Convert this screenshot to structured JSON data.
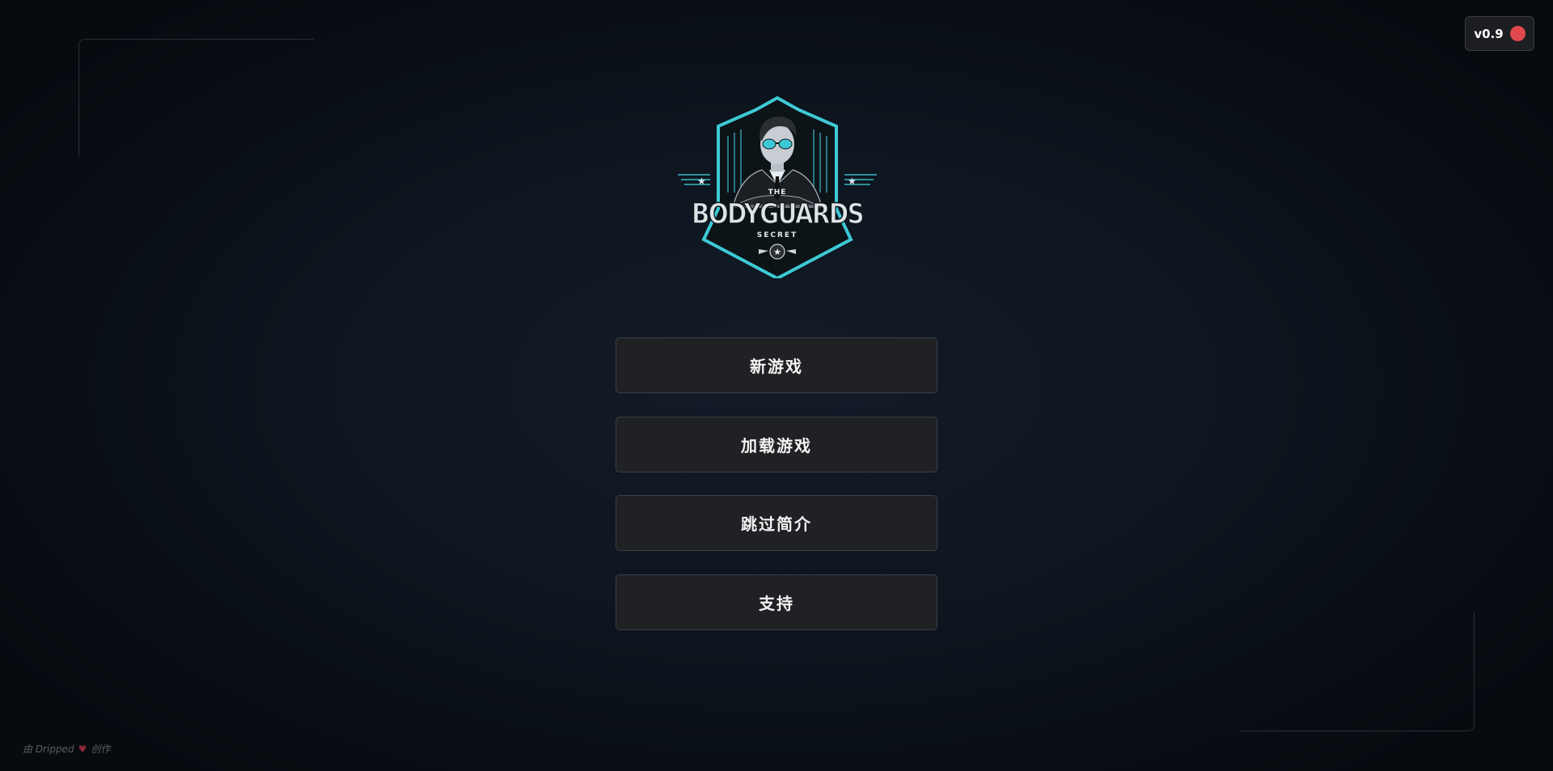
{
  "version": {
    "label": "v0.9",
    "status_color": "#e0484e"
  },
  "logo": {
    "text_top": "THE",
    "text_main": "BODYGUARDS",
    "text_sub": "SECRET",
    "accent_color": "#3ec9d6"
  },
  "menu": {
    "items": [
      {
        "label": "新游戏"
      },
      {
        "label": "加载游戏"
      },
      {
        "label": "跳过简介"
      },
      {
        "label": "支持"
      }
    ]
  },
  "credit": {
    "prefix": "由 Dripped",
    "icon": "heart-icon",
    "suffix": "创作"
  }
}
